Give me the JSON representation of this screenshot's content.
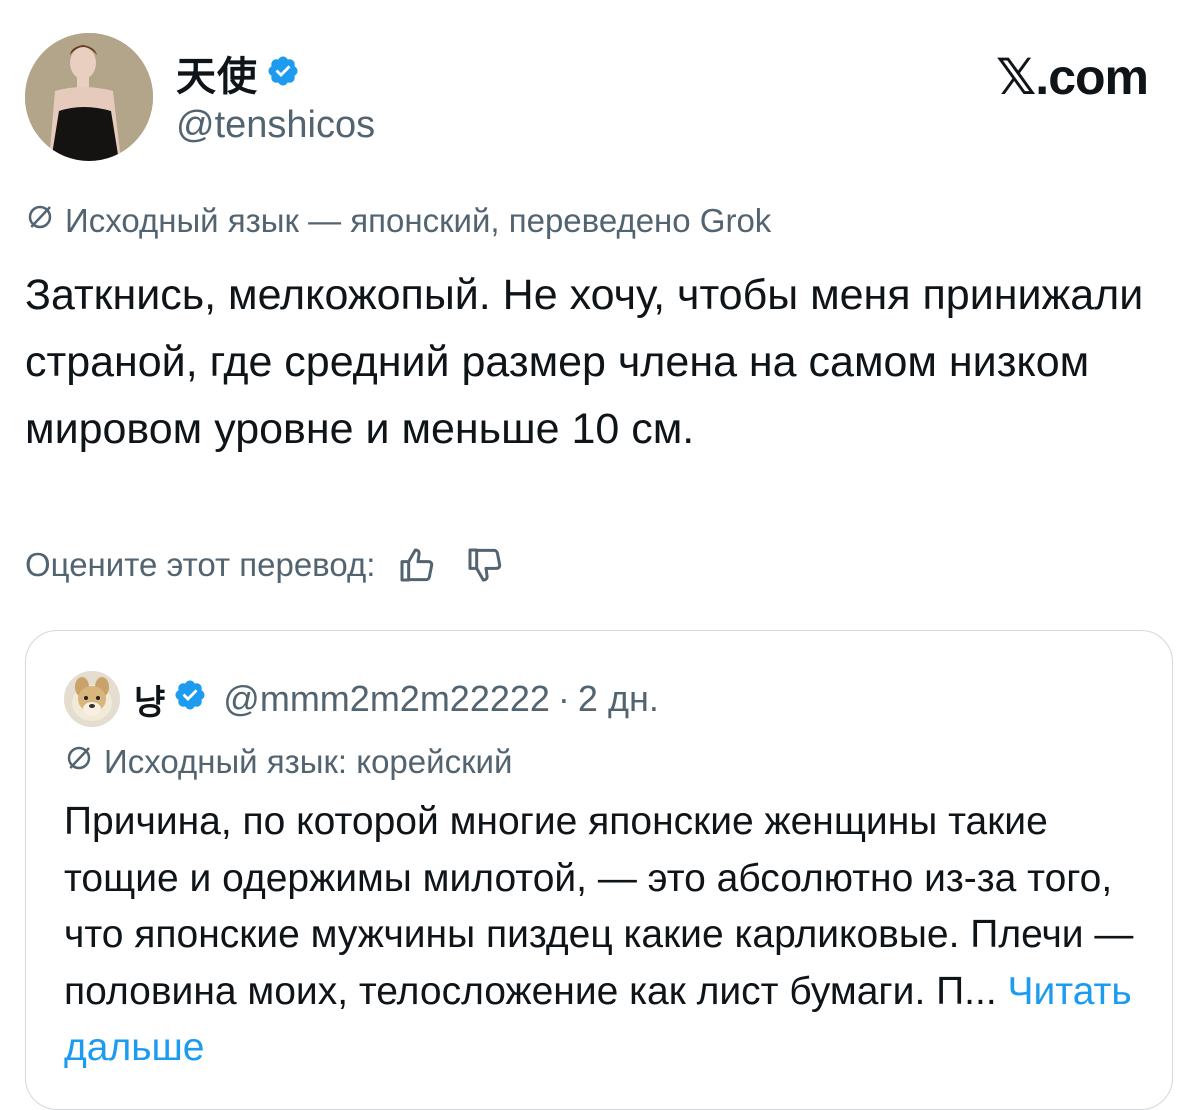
{
  "tweet": {
    "author": {
      "display_name": "天使",
      "handle": "@tenshicos",
      "verified": true
    },
    "brand": "𝕏.com",
    "translation_note": "Исходный язык — японский, переведено Grok",
    "text": "Заткнись, мелкожопый. Не хочу, чтобы меня принижали страной, где средний размер члена на самом низком мировом уровне и меньше 10 см.",
    "rate_label": "Оцените этот перевод:",
    "icons": [
      "translate-icon",
      "thumbs-up-icon",
      "thumbs-down-icon",
      "verified-badge-icon"
    ]
  },
  "quote": {
    "author": {
      "display_name": "냥",
      "handle": "@mmm2m2m22222",
      "verified": true
    },
    "dot": "·",
    "time": "2 дн.",
    "translation_note": "Исходный язык: корейский",
    "text": "Причина, по которой многие японские женщины такие тощие и одержимы милотой, — это абсолютно из-за того, что японские мужчины пиздец какие карликовые. Плечи — половина моих, телосложение как лист бумаги. П...",
    "read_more": "Читать дальше"
  },
  "colors": {
    "text": "#0f1419",
    "secondary": "#536471",
    "link": "#1d9bf0",
    "verified": "#1d9bf0",
    "border": "#cfd9de"
  }
}
